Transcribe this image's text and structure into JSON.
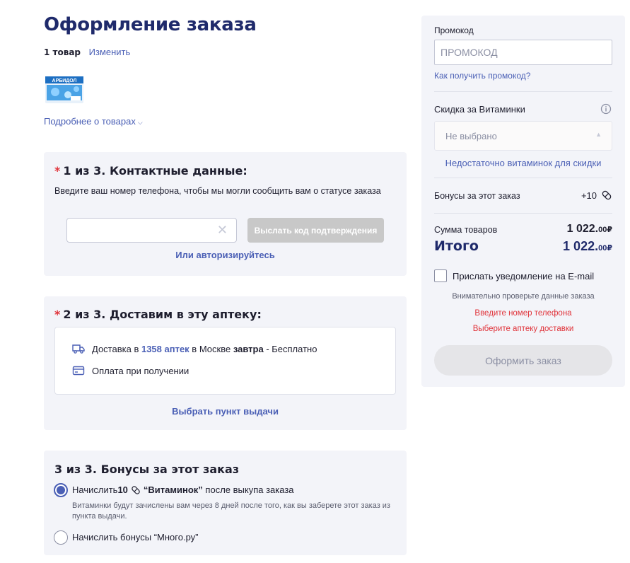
{
  "page": {
    "title": "Оформление заказа",
    "items_count": "1 товар",
    "items_change": "Изменить",
    "more_link": "Подробнее о товарах",
    "product_brand": "АРБИДОЛ"
  },
  "step1": {
    "required_mark": "*",
    "title": "1 из 3. Контактные данные:",
    "description": "Введите ваш номер телефона, чтобы мы могли сообщить вам о статусе заказа",
    "phone_value": "",
    "clear_glyph": "✕",
    "send_code_label": "Выслать код подтверждения",
    "auth_link": "Или авторизируйтесь"
  },
  "step2": {
    "required_mark": "*",
    "title": "2 из 3. Доставим в эту аптеку:",
    "delivery_prefix": "Доставка в ",
    "delivery_count": "1358 аптек",
    "delivery_mid": " в Москве ",
    "delivery_when": "завтра",
    "delivery_suffix": " - Бесплатно",
    "payment_text": "Оплата при получении",
    "pickup_link": "Выбрать пункт выдачи"
  },
  "step3": {
    "title": "3 из 3. Бонусы за этот заказ",
    "option1_prefix": "Начислить ",
    "option1_amount": "10",
    "option1_name": "“Витаминок”",
    "option1_suffix": " после выкупа заказа",
    "option1_note": "Витаминки будут зачислены вам через 8 дней после того, как вы заберете этот заказ из пункта выдачи.",
    "option2_label": "Начислить бонусы “Много.ру”",
    "selected": 1
  },
  "sidebar": {
    "promo_label": "Промокод",
    "promo_placeholder": "ПРОМОКОД",
    "promo_help": "Как получить промокод?",
    "vitamin_label": "Скидка за Витаминки",
    "vitamin_select_value": "Не выбрано",
    "vitamin_warning": "Недостаточно витаминок для скидки",
    "bonus_label": "Бонусы за этот заказ",
    "bonus_value": "+10",
    "sum_label": "Сумма товаров",
    "sum_main": "1 022.",
    "sum_cents": "00",
    "currency": "₽",
    "total_label": "Итого",
    "total_main": "1 022.",
    "total_cents": "00",
    "email_label": "Прислать уведомление на E-mail",
    "check_note": "Внимательно проверьте данные заказа",
    "error_phone": "Введите номер телефона",
    "error_pharmacy": "Выберите аптеку доставки",
    "submit_label": "Оформить заказ"
  },
  "colors": {
    "brand_navy": "#1f2a6b",
    "accent_blue": "#4a5fb5",
    "error_red": "#e0333a",
    "card_bg": "#f3f4f9"
  }
}
